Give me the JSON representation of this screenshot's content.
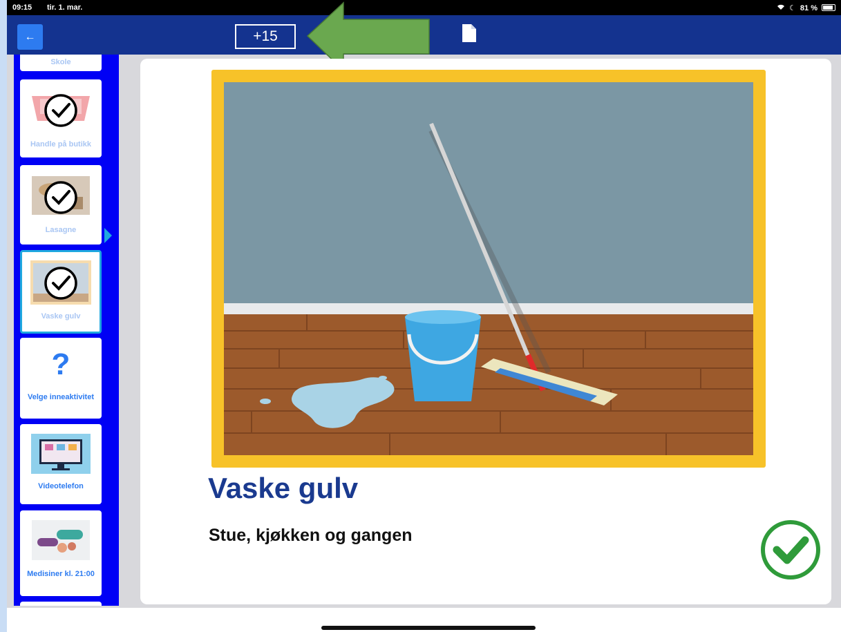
{
  "status_bar": {
    "time": "09:15",
    "date": "tir. 1. mar.",
    "battery_text": "81 %"
  },
  "nav_bar": {
    "back_icon": "←",
    "counter": "+15",
    "document_icon": "document-icon"
  },
  "sidebar": {
    "items": [
      {
        "label": "Skole",
        "completed": true
      },
      {
        "label": "Handle på butikk",
        "completed": true
      },
      {
        "label": "Lasagne",
        "completed": true
      },
      {
        "label": "Vaske gulv",
        "completed": true,
        "active": true
      },
      {
        "label": "Velge inneaktivitet",
        "icon": "?"
      },
      {
        "label": "Videotelefon"
      },
      {
        "label": "Medisiner kl. 21:00"
      }
    ]
  },
  "activity": {
    "title": "Vaske gulv",
    "subtitle": "Stue, kjøkken og gangen"
  },
  "colors": {
    "nav_bar": "#14338f",
    "sidebar": "#0000f5",
    "accent": "#2d7bf0",
    "title": "#1a3a8f",
    "frame": "#f7c229",
    "done": "#2f9b3a"
  }
}
